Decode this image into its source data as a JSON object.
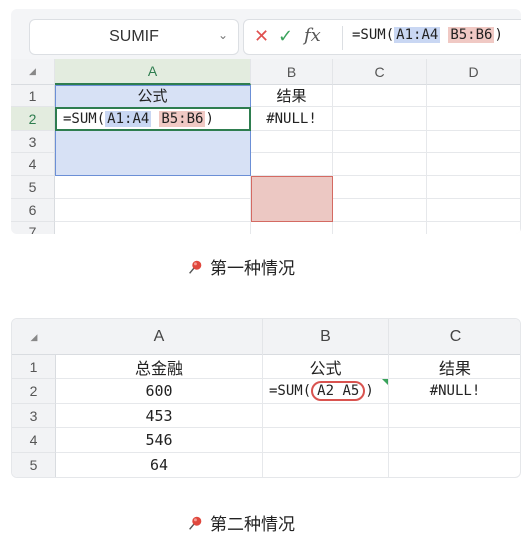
{
  "panel1": {
    "name_box": "SUMIF",
    "formula_bar": {
      "prefix": "=SUM(",
      "ref1": "A1:A4",
      "ref2": "B5:B6",
      "suffix": ")"
    },
    "columns": [
      "A",
      "B",
      "C",
      "D"
    ],
    "rows": [
      "1",
      "2",
      "3",
      "4",
      "5",
      "6",
      "7"
    ],
    "cells": {
      "A1": "公式",
      "B1": "结果",
      "A2_prefix": "=SUM(",
      "A2_ref1": "A1:A4",
      "A2_ref2": "B5:B6",
      "A2_suffix": ")",
      "B2": "#NULL!"
    },
    "colors": {
      "ref1_highlight": "#c9d7f3",
      "ref2_highlight": "#f0c9c4",
      "selection_border": "#2e7d4f"
    }
  },
  "caption1": "第一种情况",
  "panel2": {
    "columns": [
      "A",
      "B",
      "C"
    ],
    "rows": [
      "1",
      "2",
      "3",
      "4",
      "5"
    ],
    "cells": {
      "A1": "总金融",
      "B1": "公式",
      "C1": "结果",
      "A2": "600",
      "A3": "453",
      "A4": "546",
      "A5": "64",
      "B2_prefix": "=SUM(",
      "B2_refs": "A2 A5",
      "B2_suffix": ")",
      "C2": "#NULL!"
    },
    "colors": {
      "circle": "#d9534f"
    }
  },
  "caption2": "第二种情况",
  "icons": {
    "caption_icon": "pushpin-icon"
  }
}
